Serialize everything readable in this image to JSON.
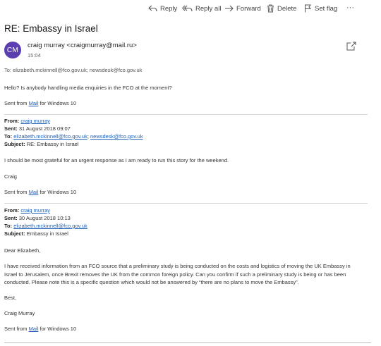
{
  "toolbar": {
    "reply": "Reply",
    "reply_all": "Reply all",
    "forward": "Forward",
    "delete": "Delete",
    "set_flag": "Set flag",
    "more": "···"
  },
  "message": {
    "subject": "RE: Embassy in Israel",
    "avatar_initials": "CM",
    "avatar_color": "#5b3fb0",
    "sender": "craig murray <craigmurray@mail.ru>",
    "time": "15:04",
    "to_line": "To: elizabeth.mckinnell@fco.gov.uk; newsdesk@fco.gov.uk",
    "body_line1": "Hello? Is anybody handling media enquiries in the FCO at the moment?",
    "sig_pre": "Sent from ",
    "sig_link": "Mail",
    "sig_post": " for Windows 10"
  },
  "quote1": {
    "from_label": "From:",
    "from_value": "craig murray",
    "sent_label": "Sent:",
    "sent_value": "31 August 2018 09:07",
    "to_label": "To:",
    "to_value1": "elizabeth.mckinnell@fco.gov.uk",
    "to_sep": "; ",
    "to_value2": "newsdesk@fco.gov.uk",
    "subject_label": "Subject:",
    "subject_value": "RE: Embassy in Israel",
    "body": "I should be most grateful for an urgent response as I am ready to run this story for the weekend.",
    "signoff": "Craig",
    "sig_pre": "Sent from ",
    "sig_link": "Mail",
    "sig_post": " for Windows 10"
  },
  "quote2": {
    "from_label": "From:",
    "from_value": "craig murray",
    "sent_label": "Sent:",
    "sent_value": "30 August 2018 10:13",
    "to_label": "To:",
    "to_value": "elizabeth.mckinnell@fco.gov.uk",
    "subject_label": "Subject:",
    "subject_value": "Embassy in Israel",
    "greeting": "Dear Elizabeth,",
    "body": "I have received information from an FCO source that a preliminary study is being conducted on the costs and logistics of moving the UK Embassy in Israel to Jerusalem, once Brexit removes the UK from the common foreign policy. Can you confirm if such a preliminary study is being or has been conducted. Please note this is a specific question which would not be answered by “there are no plans to move the Embassy”.",
    "closing": "Best,",
    "name": "Craig Murray",
    "sig_pre": "Sent from ",
    "sig_link": "Mail",
    "sig_post": " for Windows 10"
  }
}
